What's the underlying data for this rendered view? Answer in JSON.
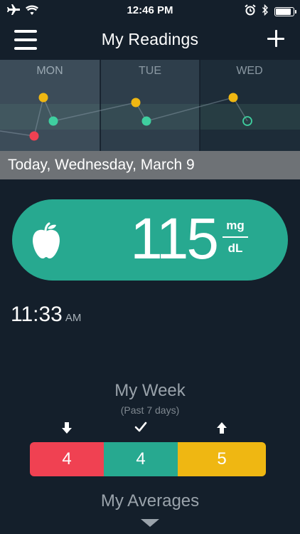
{
  "status_bar": {
    "time": "12:46 PM",
    "icons": [
      "airplane-icon",
      "wifi-icon",
      "alarm-icon",
      "bluetooth-icon",
      "battery-icon"
    ]
  },
  "nav": {
    "title": "My Readings",
    "menu_icon": "hamburger-menu-icon",
    "add_icon": "plus-icon"
  },
  "chart_data": {
    "type": "scatter",
    "days": [
      "MON",
      "TUE",
      "WED"
    ],
    "colors": {
      "high": "#efb712",
      "in_range": "#3fcf9f",
      "low": "#f04152"
    }
  },
  "today": {
    "label": "Today, Wednesday, March 9"
  },
  "reading": {
    "icon": "apple-icon",
    "value": "115",
    "unit_top": "mg",
    "unit_bottom": "dL",
    "time": "11:33",
    "ampm": "AM"
  },
  "week": {
    "title": "My Week",
    "subtitle": "(Past 7 days)",
    "indicators": [
      "arrow-down-icon",
      "checkmark-icon",
      "arrow-up-icon"
    ],
    "low": "4",
    "in_range": "4",
    "high": "5"
  },
  "averages": {
    "title": "My Averages",
    "icon": "chevron-down-icon"
  },
  "colors": {
    "background": "#141f2b",
    "accent_green": "#27a990",
    "low_red": "#f04152",
    "high_yellow": "#efb712"
  }
}
